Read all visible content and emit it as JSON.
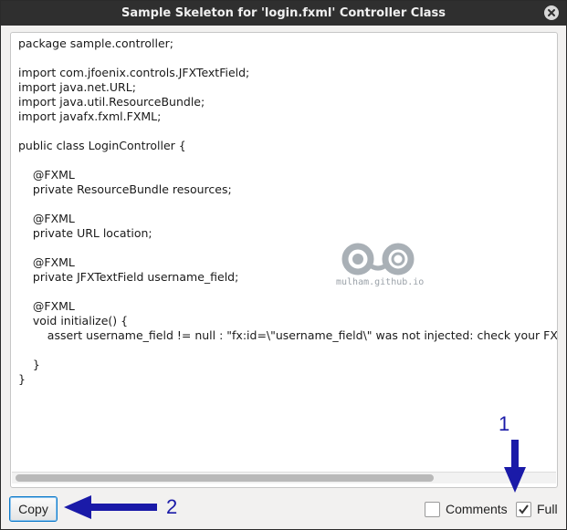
{
  "window": {
    "title": "Sample Skeleton for 'login.fxml' Controller Class"
  },
  "code": {
    "text": "package sample.controller;\n\nimport com.jfoenix.controls.JFXTextField;\nimport java.net.URL;\nimport java.util.ResourceBundle;\nimport javafx.fxml.FXML;\n\npublic class LoginController {\n\n    @FXML\n    private ResourceBundle resources;\n\n    @FXML\n    private URL location;\n\n    @FXML\n    private JFXTextField username_field;\n\n    @FXML\n    void initialize() {\n        assert username_field != null : \"fx:id=\\\"username_field\\\" was not injected: check your FXML file 'login.fxml'.\";\n\n    }\n}"
  },
  "watermark": {
    "text": "mulham.github.io"
  },
  "footer": {
    "copy_label": "Copy",
    "comments_label": "Comments",
    "comments_checked": false,
    "full_label": "Full",
    "full_checked": true
  },
  "annotations": {
    "marker_1": "1",
    "marker_2": "2",
    "color": "#1a1aa8"
  },
  "icons": [
    "close-icon",
    "checkmark-icon",
    "arrow-down-icon",
    "arrow-left-icon"
  ]
}
